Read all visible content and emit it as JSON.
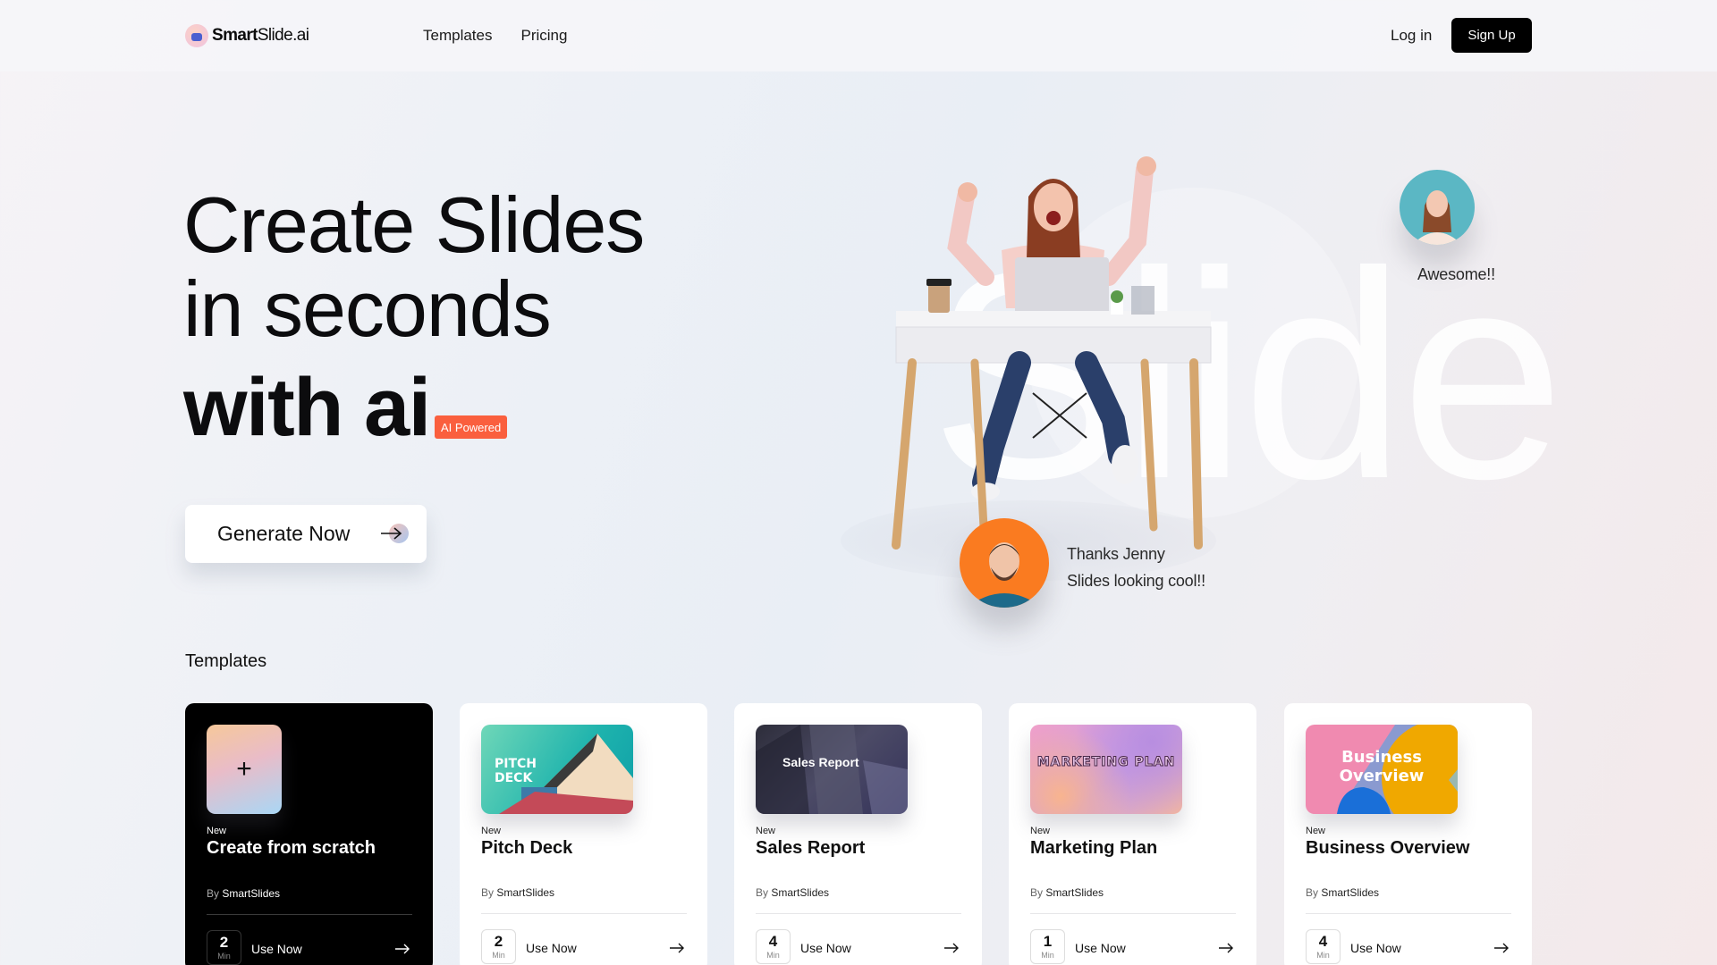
{
  "nav": {
    "logo_bold": "Smart",
    "logo_rest": "Slide.ai",
    "links": [
      "Templates",
      "Pricing"
    ],
    "login": "Log in",
    "signup": "Sign Up"
  },
  "hero": {
    "line1": "Create Slides",
    "line2": "in seconds",
    "line3": "with ai",
    "badge": "AI Powered",
    "cta": "Generate Now",
    "background_word": "Slide",
    "accent_color": "#fa5f3e"
  },
  "testimonials": {
    "jenny_message": "Awesome!!",
    "reply_line1": "Thanks Jenny",
    "reply_line2": "Slides looking cool!!"
  },
  "templates": {
    "section_title": "Templates",
    "cards": [
      {
        "tag": "New",
        "title": "Create from scratch",
        "by_label": "By",
        "author": "SmartSlides",
        "minutes": "2",
        "min_unit": "Min",
        "action": "Use Now",
        "thumb_icon": "+"
      },
      {
        "tag": "New",
        "title": "Pitch Deck",
        "by_label": "By",
        "author": "SmartSlides",
        "minutes": "2",
        "min_unit": "Min",
        "action": "Use Now",
        "thumb_text": "PITCH DECK"
      },
      {
        "tag": "New",
        "title": "Sales Report",
        "by_label": "By",
        "author": "SmartSlides",
        "minutes": "4",
        "min_unit": "Min",
        "action": "Use Now",
        "thumb_text": "Sales Report"
      },
      {
        "tag": "New",
        "title": "Marketing Plan",
        "by_label": "By",
        "author": "SmartSlides",
        "minutes": "1",
        "min_unit": "Min",
        "action": "Use Now",
        "thumb_text": "MARKETING PLAN"
      },
      {
        "tag": "New",
        "title": "Business Overview",
        "by_label": "By",
        "author": "SmartSlides",
        "minutes": "4",
        "min_unit": "Min",
        "action": "Use Now",
        "thumb_text": "Business Overview"
      }
    ]
  }
}
